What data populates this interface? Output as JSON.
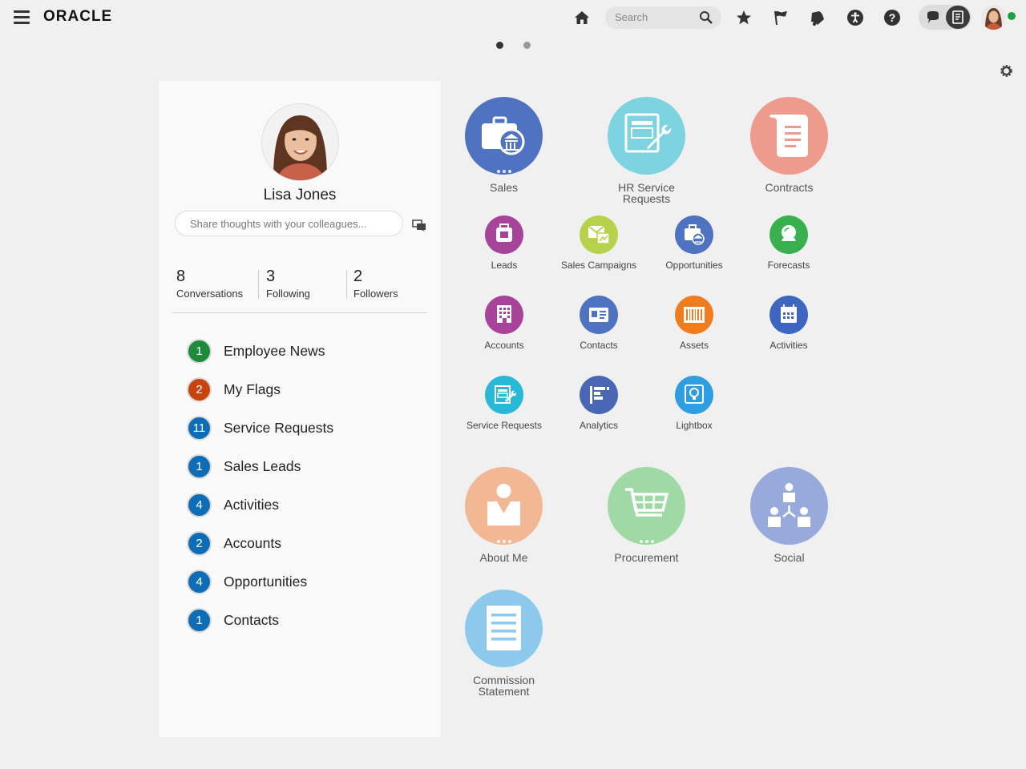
{
  "header": {
    "brand": "ORACLE",
    "search_placeholder": "Search",
    "icons": [
      "menu-icon",
      "home-icon",
      "search-icon",
      "star-icon",
      "flag-icon",
      "bell-icon",
      "accessibility-icon",
      "help-icon",
      "chat-icon",
      "notes-icon",
      "user-avatar"
    ],
    "presence_color": "#1aa03c"
  },
  "pager": {
    "pages": 2,
    "active": 1
  },
  "profile": {
    "name": "Lisa Jones",
    "share_placeholder": "Share thoughts with your colleagues...",
    "stats": [
      {
        "value": "8",
        "label": "Conversations"
      },
      {
        "value": "3",
        "label": "Following"
      },
      {
        "value": "2",
        "label": "Followers"
      }
    ],
    "worklist": [
      {
        "count": "1",
        "label": "Employee News",
        "color": "#1e8a3c"
      },
      {
        "count": "2",
        "label": "My Flags",
        "color": "#c8440f"
      },
      {
        "count": "11",
        "label": "Service Requests",
        "color": "#0f6db8"
      },
      {
        "count": "1",
        "label": "Sales Leads",
        "color": "#0f6db8"
      },
      {
        "count": "4",
        "label": "Activities",
        "color": "#0f6db8"
      },
      {
        "count": "2",
        "label": "Accounts",
        "color": "#0f6db8"
      },
      {
        "count": "4",
        "label": "Opportunities",
        "color": "#0f6db8"
      },
      {
        "count": "1",
        "label": "Contacts",
        "color": "#0f6db8"
      }
    ]
  },
  "apps": {
    "sales": {
      "label": "Sales",
      "color": "#4f73c0"
    },
    "hr_service_requests": {
      "label": "HR Service\nRequests",
      "color": "#7dd3e0"
    },
    "contracts": {
      "label": "Contracts",
      "color": "#ee9a8c"
    },
    "leads": {
      "label": "Leads",
      "color": "#a8439a"
    },
    "sales_campaigns": {
      "label": "Sales Campaigns",
      "color": "#b6d24a"
    },
    "opportunities": {
      "label": "Opportunities",
      "color": "#4f73c0"
    },
    "forecasts": {
      "label": "Forecasts",
      "color": "#37b04d"
    },
    "accounts": {
      "label": "Accounts",
      "color": "#a8439a"
    },
    "contacts": {
      "label": "Contacts",
      "color": "#4f73c0"
    },
    "assets": {
      "label": "Assets",
      "color": "#f07c1e"
    },
    "activities": {
      "label": "Activities",
      "color": "#3e66c0"
    },
    "service_requests": {
      "label": "Service Requests",
      "color": "#27b9d6"
    },
    "analytics": {
      "label": "Analytics",
      "color": "#4a67b6"
    },
    "lightbox": {
      "label": "Lightbox",
      "color": "#2f9ee0"
    },
    "about_me": {
      "label": "About Me",
      "color": "#f2b896"
    },
    "procurement": {
      "label": "Procurement",
      "color": "#9fd9a4"
    },
    "social": {
      "label": "Social",
      "color": "#98a9dc"
    },
    "commission_statement": {
      "label": "Commission\nStatement",
      "color": "#8cc9ec"
    }
  }
}
